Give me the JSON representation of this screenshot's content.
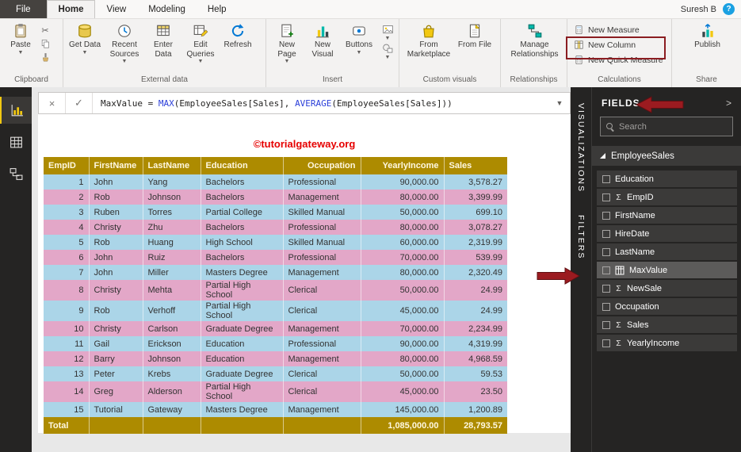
{
  "app": {
    "tabs": [
      "File",
      "Home",
      "View",
      "Modeling",
      "Help"
    ],
    "user_name": "Suresh B",
    "help_label": "?"
  },
  "ribbon": {
    "clipboard": {
      "caption": "Clipboard",
      "paste": "Paste"
    },
    "external": {
      "caption": "External data",
      "get_data": "Get Data",
      "recent_sources": "Recent Sources",
      "enter_data": "Enter Data",
      "edit_queries": "Edit Queries",
      "refresh": "Refresh"
    },
    "insert": {
      "caption": "Insert",
      "new_page": "New Page",
      "new_visual": "New Visual",
      "buttons": "Buttons"
    },
    "custom": {
      "caption": "Custom visuals",
      "from_marketplace": "From Marketplace",
      "from_file": "From File"
    },
    "relationships": {
      "caption": "Relationships",
      "manage": "Manage Relationships"
    },
    "calculations": {
      "caption": "Calculations",
      "new_measure": "New Measure",
      "new_column": "New Column",
      "new_quick_measure": "New Quick Measure"
    },
    "share": {
      "caption": "Share",
      "publish": "Publish"
    }
  },
  "formula": {
    "p1": "MaxValue = ",
    "fn1": "MAX",
    "p2": "(EmployeeSales[Sales], ",
    "fn2": "AVERAGE",
    "p3": "(EmployeeSales[Sales]))"
  },
  "canvas": {
    "watermark": "©tutorialgateway.org"
  },
  "side_tabs": {
    "visualizations": "VISUALIZATIONS",
    "filters": "FILTERS"
  },
  "fields_panel": {
    "title": "FIELDS",
    "collapse_glyph": ">",
    "search_placeholder": "Search",
    "table_name": "EmployeeSales",
    "fields": [
      {
        "name": "Education",
        "sigma": false,
        "calc": false,
        "selected": false
      },
      {
        "name": "EmpID",
        "sigma": true,
        "calc": false,
        "selected": false
      },
      {
        "name": "FirstName",
        "sigma": false,
        "calc": false,
        "selected": false
      },
      {
        "name": "HireDate",
        "sigma": false,
        "calc": false,
        "selected": false
      },
      {
        "name": "LastName",
        "sigma": false,
        "calc": false,
        "selected": false
      },
      {
        "name": "MaxValue",
        "sigma": false,
        "calc": true,
        "selected": true
      },
      {
        "name": "NewSale",
        "sigma": true,
        "calc": false,
        "selected": false
      },
      {
        "name": "Occupation",
        "sigma": false,
        "calc": false,
        "selected": false
      },
      {
        "name": "Sales",
        "sigma": true,
        "calc": false,
        "selected": false
      },
      {
        "name": "YearlyIncome",
        "sigma": true,
        "calc": false,
        "selected": false
      }
    ]
  },
  "table": {
    "headers": [
      "EmpID",
      "FirstName",
      "LastName",
      "Education",
      "Occupation",
      "YearlyIncome",
      "Sales"
    ],
    "rows": [
      [
        "1",
        "John",
        "Yang",
        "Bachelors",
        "Professional",
        "90,000.00",
        "3,578.27"
      ],
      [
        "2",
        "Rob",
        "Johnson",
        "Bachelors",
        "Management",
        "80,000.00",
        "3,399.99"
      ],
      [
        "3",
        "Ruben",
        "Torres",
        "Partial College",
        "Skilled Manual",
        "50,000.00",
        "699.10"
      ],
      [
        "4",
        "Christy",
        "Zhu",
        "Bachelors",
        "Professional",
        "80,000.00",
        "3,078.27"
      ],
      [
        "5",
        "Rob",
        "Huang",
        "High School",
        "Skilled Manual",
        "60,000.00",
        "2,319.99"
      ],
      [
        "6",
        "John",
        "Ruiz",
        "Bachelors",
        "Professional",
        "70,000.00",
        "539.99"
      ],
      [
        "7",
        "John",
        "Miller",
        "Masters Degree",
        "Management",
        "80,000.00",
        "2,320.49"
      ],
      [
        "8",
        "Christy",
        "Mehta",
        "Partial High School",
        "Clerical",
        "50,000.00",
        "24.99"
      ],
      [
        "9",
        "Rob",
        "Verhoff",
        "Partial High School",
        "Clerical",
        "45,000.00",
        "24.99"
      ],
      [
        "10",
        "Christy",
        "Carlson",
        "Graduate Degree",
        "Management",
        "70,000.00",
        "2,234.99"
      ],
      [
        "11",
        "Gail",
        "Erickson",
        "Education",
        "Professional",
        "90,000.00",
        "4,319.99"
      ],
      [
        "12",
        "Barry",
        "Johnson",
        "Education",
        "Management",
        "80,000.00",
        "4,968.59"
      ],
      [
        "13",
        "Peter",
        "Krebs",
        "Graduate Degree",
        "Clerical",
        "50,000.00",
        "59.53"
      ],
      [
        "14",
        "Greg",
        "Alderson",
        "Partial High School",
        "Clerical",
        "45,000.00",
        "23.50"
      ],
      [
        "15",
        "Tutorial",
        "Gateway",
        "Masters Degree",
        "Management",
        "145,000.00",
        "1,200.89"
      ]
    ],
    "total": {
      "label": "Total",
      "yearly_income": "1,085,000.00",
      "sales": "28,793.57"
    }
  }
}
